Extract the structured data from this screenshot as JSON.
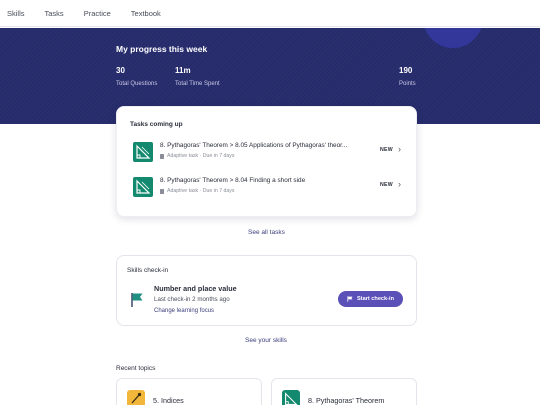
{
  "nav": {
    "items": [
      {
        "label": "Skills"
      },
      {
        "label": "Tasks"
      },
      {
        "label": "Practice"
      },
      {
        "label": "Textbook"
      }
    ]
  },
  "progress": {
    "title": "My progress this week",
    "stats": [
      {
        "value": "30",
        "label": "Total Questions"
      },
      {
        "value": "11m",
        "label": "Total Time Spent"
      },
      {
        "value": "190",
        "label": "Points"
      }
    ]
  },
  "tasks": {
    "title": "Tasks coming up",
    "items": [
      {
        "name": "8. Pythagoras' Theorem > 8.05 Applications of Pythagoras' theor...",
        "meta": "Adaptive task · Due in 7 days",
        "badge": "NEW"
      },
      {
        "name": "8. Pythagoras' Theorem > 8.04 Finding a short side",
        "meta": "Adaptive task · Due in 7 days",
        "badge": "NEW"
      }
    ],
    "see_all": "See all tasks"
  },
  "skills_checkin": {
    "title": "Skills check-in",
    "skill_name": "Number and place value",
    "last_checkin": "Last check-in 2 months ago",
    "change_focus": "Change learning focus",
    "start_label": "Start check-in",
    "see_skills": "See your skills"
  },
  "recent": {
    "title": "Recent topics",
    "topics": [
      {
        "name": "5. Indices"
      },
      {
        "name": "8. Pythagoras' Theorem"
      }
    ]
  },
  "colors": {
    "hero_bg": "#262b6b",
    "task_thumb": "#138a6f",
    "accent_button": "#5b50b8",
    "indices_thumb": "#f1b73a"
  }
}
